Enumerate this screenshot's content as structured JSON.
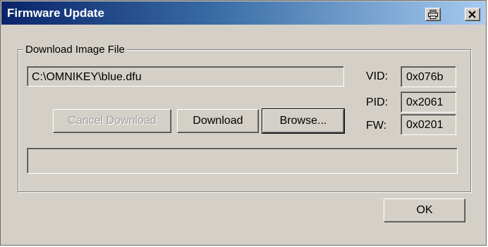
{
  "window": {
    "title": "Firmware Update",
    "colors": {
      "title_start": "#0a246a",
      "title_end": "#a6caf0",
      "face": "#d4d0c8"
    },
    "title_icons": [
      "print-icon",
      "close-icon"
    ]
  },
  "group": {
    "label": "Download Image File",
    "file_path": "C:\\OMNIKEY\\blue.dfu",
    "cancel_label": "Cancel Download",
    "download_label": "Download",
    "browse_label": "Browse...",
    "progress_percent": 0,
    "ids": [
      {
        "label": "VID:",
        "value": "0x076b"
      },
      {
        "label": "PID:",
        "value": "0x2061"
      },
      {
        "label": "FW:",
        "value": "0x0201"
      }
    ]
  },
  "ok_label": "OK"
}
